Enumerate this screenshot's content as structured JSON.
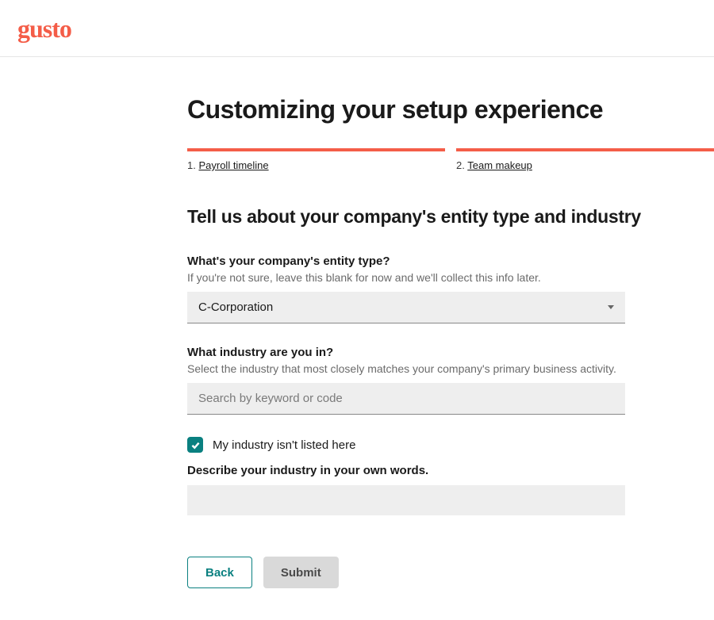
{
  "logo_text": "gusto",
  "page_title": "Customizing your setup experience",
  "progress": {
    "steps": [
      {
        "number": "1.",
        "label": "Payroll timeline"
      },
      {
        "number": "2.",
        "label": "Team makeup"
      }
    ]
  },
  "section_title": "Tell us about your company's entity type and industry",
  "entity": {
    "label": "What's your company's entity type?",
    "hint": "If you're not sure, leave this blank for now and we'll collect this info later.",
    "selected": "C-Corporation"
  },
  "industry": {
    "label": "What industry are you in?",
    "hint": "Select the industry that most closely matches your company's primary business activity.",
    "placeholder": "Search by keyword or code"
  },
  "not_listed": {
    "label": "My industry isn't listed here",
    "checked": true
  },
  "describe": {
    "label": "Describe your industry in your own words.",
    "value": ""
  },
  "buttons": {
    "back": "Back",
    "submit": "Submit"
  },
  "colors": {
    "brand": "#f45d48",
    "accent": "#0a8080"
  }
}
